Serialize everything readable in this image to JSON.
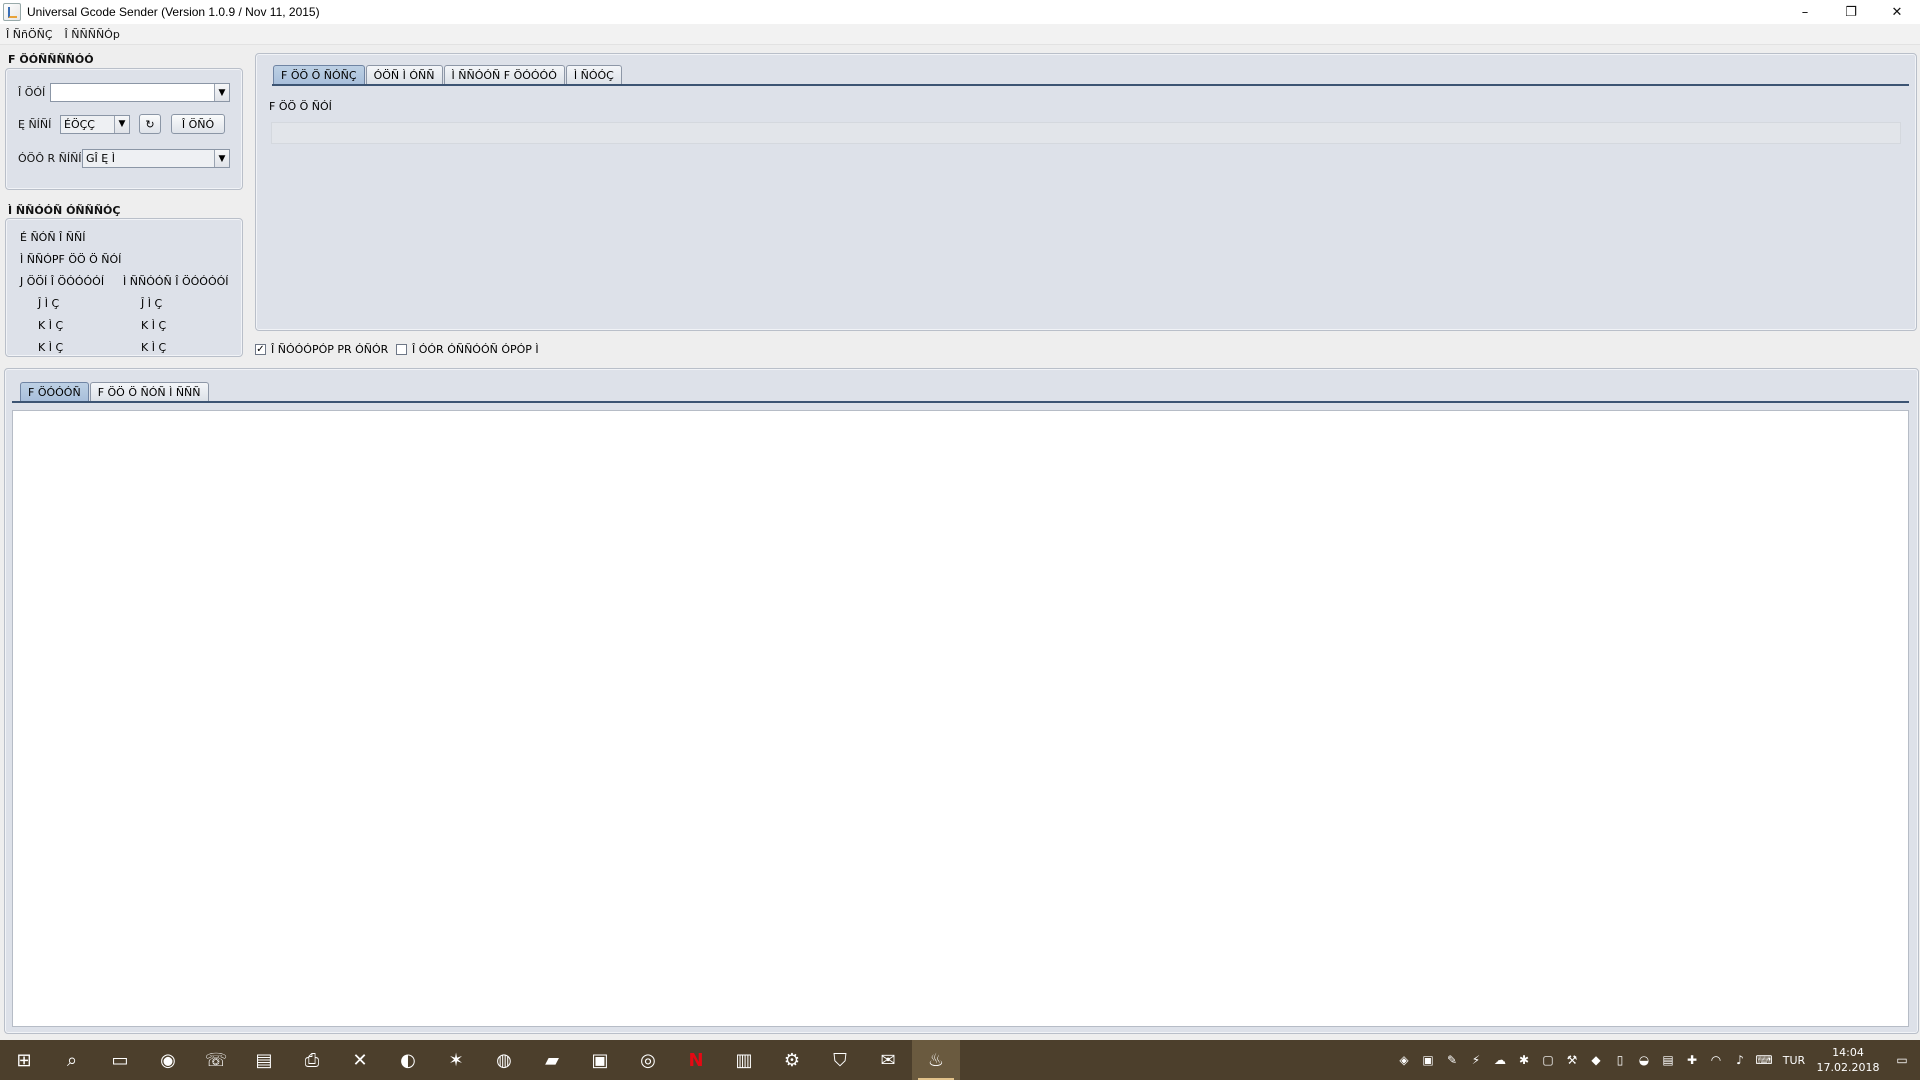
{
  "window": {
    "title": "Universal Gcode Sender (Version 1.0.9 / Nov 11, 2015)",
    "minimize": "–",
    "restore": "❐",
    "close": "✕"
  },
  "menu": [
    "Î ÑñÖÑÇ",
    "Î ÑÑÑÑÓp"
  ],
  "connection": {
    "title": "F ÖÓÑÑÑÑÓÓ",
    "port_label": "Î ÖÓÍ",
    "port_value": "",
    "baud_label": "Ę ÑÍÑÍ",
    "baud_value": "ÉÖÇÇ",
    "refresh_icon": "↻",
    "open_button": "Î ÖÑÓ",
    "firmware_label": "ÓÖÔ R ÑÍÑÍ",
    "firmware_value": "GÎ Ę Ì"
  },
  "machine_status": {
    "title": "Ì ÑÑÓÓÑ ÓÑÑÑÓÇ",
    "active_state": "É ÑÓÑ Î ÑÑÍ",
    "latest_comment": "Ì ÑÑÓPF ÖÖ Ö ÑÓÍ",
    "work_position_label": "J ÖÖÍ Î ÖÓÓÓÓÍ",
    "machine_position_label": "Ì ÑÑÓÓÑ Î ÖÓÓÓÓÍ",
    "work_coords": [
      "Ĵ Ì Ç",
      "K Ì Ç",
      "K Ì Ç"
    ],
    "machine_coords": [
      "Ĵ Ì Ç",
      "K Ì Ç",
      "K Ì Ç"
    ]
  },
  "top_tabs": [
    "F ÖÖ Ö ÑÓÑÇ",
    "ÓÖÑ Ì ÓÑÑ",
    "Ì ÑÑÓÓÑ F ÖÓÓÓÓ",
    "Ì ÑÓÓÇ"
  ],
  "file_mode": {
    "label": "F ÖÖ Ö ÑÓÍ"
  },
  "options": {
    "scroll_output": "Î ÑÓÓÓPÓP PR ÓÑÓR",
    "show_verbose": "Î ÓÓR ÓÑÑÓÓÑ ÓPÓP Ì"
  },
  "bottom_tabs": [
    "F ÖÓÓÓÑ",
    "F ÖÖ Ö ÑÓÑ Ì ÑÑÑ"
  ],
  "taskbar": {
    "lang": "TUR",
    "time": "14:04",
    "date": "17.02.2018"
  }
}
